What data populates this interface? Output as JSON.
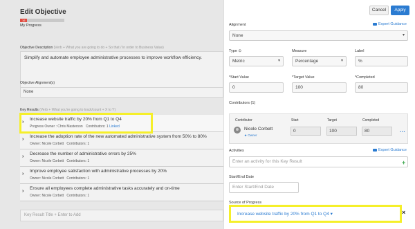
{
  "left": {
    "title": "Edit Objective",
    "progress_percent": 16,
    "progress_label": "16",
    "my_progress": "My Progress",
    "description_label": "Objective Description",
    "description_hint": " (Verb + What you are going to do + So that / In order to Business Value)",
    "description_text": "Simplify and automate employee administrative processes to improve workflow efficiency.",
    "alignment_label": "Objective Alignment(s)",
    "alignment_value": "None",
    "key_results_label": "Key Results",
    "key_results_hint": " (Verb + What you're going to track/count + X to Y)",
    "key_results": [
      {
        "title": "Increase website traffic by 20% from Q1 to Q4",
        "owner": "Progress Owner : Chris Masterson",
        "contributors": "Contributors: 1",
        "linked": "Linked"
      },
      {
        "title": "Increase the adoption rate of the new automated administrative system from 50% to 80%",
        "owner": "Owner: Nicole Corbett",
        "contributors": "Contributors: 1",
        "linked": ""
      },
      {
        "title": "Decrease the number of administrative errors by 25%",
        "owner": "Owner: Nicole Corbett",
        "contributors": "Contributors: 1",
        "linked": ""
      },
      {
        "title": "Improve employee satisfaction with administrative processes by 20%",
        "owner": "Owner: Nicole Corbett",
        "contributors": "Contributors: 1",
        "linked": ""
      },
      {
        "title": "Ensure all employees complete administrative tasks accurately and on-time",
        "owner": "Owner: Nicole Corbett",
        "contributors": "Contributors: 1",
        "linked": ""
      }
    ],
    "add_placeholder": "Key Result Title + Enter to Add"
  },
  "right": {
    "cancel": "Cancel",
    "apply": "Apply",
    "alignment_label": "Alignment",
    "expert_guidance": "Expert Guidance",
    "alignment_value": "None",
    "type_label": "Type",
    "type_value": "Metric",
    "measure_label": "Measure",
    "measure_value": "Percentage",
    "label_label": "Label",
    "label_value": "%",
    "start_label": "*Start Value",
    "start_value": "0",
    "target_label": "*Target Value",
    "target_value": "100",
    "completed_label": "*Completed",
    "completed_value": "80",
    "contributors_label": "Contributors (1)",
    "col_contributor": "Contributor",
    "col_start": "Start",
    "col_target": "Target",
    "col_completed": "Completed",
    "contributor_name": "Nicole Corbett",
    "contributor_role": "★ Owner",
    "c_start": "0",
    "c_target": "100",
    "c_completed": "80",
    "activities_label": "Activities",
    "activity_placeholder": "Enter an activity for this Key Result",
    "date_label": "Start/End Date",
    "date_placeholder": "Enter Start/End Date",
    "source_label": "Source of Progress",
    "source_value": "Increase website traffic by 20% from Q1 to Q4 ▾"
  }
}
